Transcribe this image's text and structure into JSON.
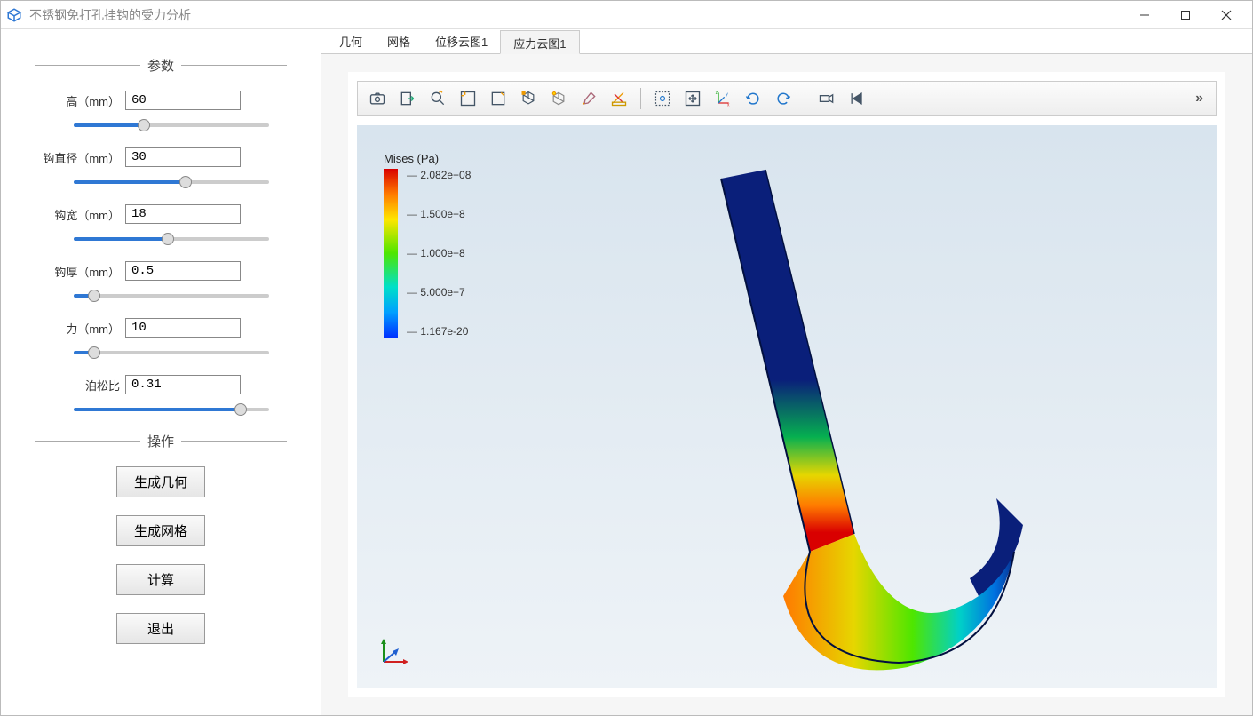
{
  "window": {
    "title": "不锈钢免打孔挂钩的受力分析"
  },
  "sidebar": {
    "params_title": "参数",
    "actions_title": "操作",
    "params": {
      "height": {
        "label": "高（mm）",
        "value": "60",
        "slider": 35
      },
      "hook_diameter": {
        "label": "钩直径（mm）",
        "value": "30",
        "slider": 58
      },
      "hook_width": {
        "label": "钩宽（mm）",
        "value": "18",
        "slider": 48
      },
      "hook_thick": {
        "label": "钩厚（mm）",
        "value": "0.5",
        "slider": 8
      },
      "force": {
        "label": "力（mm）",
        "value": "10",
        "slider": 8
      },
      "poisson": {
        "label": "泊松比",
        "value": "0.31",
        "slider": 88
      }
    },
    "buttons": {
      "gen_geom": "生成几何",
      "gen_mesh": "生成网格",
      "compute": "计算",
      "exit": "退出"
    }
  },
  "tabs": {
    "items": [
      {
        "label": "几何",
        "active": false
      },
      {
        "label": "网格",
        "active": false
      },
      {
        "label": "位移云图1",
        "active": false
      },
      {
        "label": "应力云图1",
        "active": true
      }
    ]
  },
  "toolbar": {
    "overflow": "»"
  },
  "legend": {
    "title": "Mises (Pa)",
    "ticks": [
      "2.082e+08",
      "1.500e+8",
      "1.000e+8",
      "5.000e+7",
      "1.167e-20"
    ]
  }
}
